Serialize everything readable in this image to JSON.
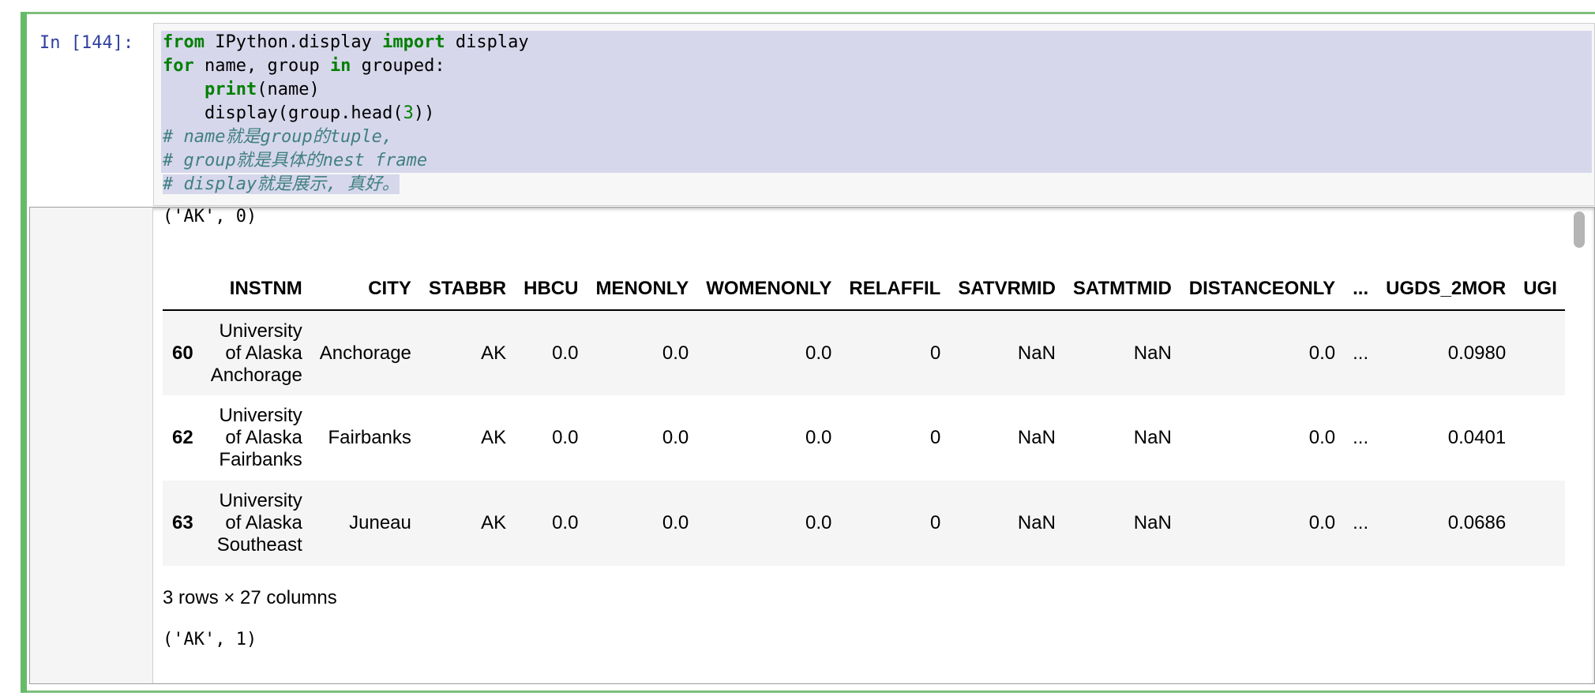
{
  "cell": {
    "prompt": "In [144]:",
    "code_lines": [
      [
        {
          "t": "from",
          "c": "kw"
        },
        {
          "t": " IPython.display ",
          "c": "plain"
        },
        {
          "t": "import",
          "c": "kw"
        },
        {
          "t": " display",
          "c": "plain"
        }
      ],
      [
        {
          "t": "for",
          "c": "kw"
        },
        {
          "t": " name, group ",
          "c": "plain"
        },
        {
          "t": "in",
          "c": "kw"
        },
        {
          "t": " grouped:",
          "c": "plain"
        }
      ],
      [
        {
          "t": "    ",
          "c": "plain"
        },
        {
          "t": "print",
          "c": "kw"
        },
        {
          "t": "(name)",
          "c": "plain"
        }
      ],
      [
        {
          "t": "    display(group.head(",
          "c": "plain"
        },
        {
          "t": "3",
          "c": "num"
        },
        {
          "t": "))",
          "c": "plain"
        }
      ],
      [
        {
          "t": "# name就是group的tuple,",
          "c": "cm"
        }
      ],
      [
        {
          "t": "# group就是具体的nest frame",
          "c": "cm"
        }
      ],
      [
        {
          "t": "# display就是展示, 真好。",
          "c": "cm"
        }
      ]
    ]
  },
  "output": {
    "group_label_0": "('AK', 0)",
    "group_label_1": "('AK', 1)",
    "rowcount": "3 rows × 27 columns",
    "table": {
      "columns": [
        "",
        "INSTNM",
        "CITY",
        "STABBR",
        "HBCU",
        "MENONLY",
        "WOMENONLY",
        "RELAFFIL",
        "SATVRMID",
        "SATMTMID",
        "DISTANCEONLY",
        "...",
        "UGDS_2MOR",
        "UGI"
      ],
      "rows": [
        {
          "index": "60",
          "instnm": [
            "University",
            "of Alaska",
            "Anchorage"
          ],
          "city": "Anchorage",
          "stabbr": "AK",
          "hbcu": "0.0",
          "menonly": "0.0",
          "womenonly": "0.0",
          "relaffil": "0",
          "satvrmid": "NaN",
          "satmtmid": "NaN",
          "distanceonly": "0.0",
          "ellipsis": "...",
          "ugds_2mor": "0.0980"
        },
        {
          "index": "62",
          "instnm": [
            "University",
            "of Alaska",
            "Fairbanks"
          ],
          "city": "Fairbanks",
          "stabbr": "AK",
          "hbcu": "0.0",
          "menonly": "0.0",
          "womenonly": "0.0",
          "relaffil": "0",
          "satvrmid": "NaN",
          "satmtmid": "NaN",
          "distanceonly": "0.0",
          "ellipsis": "...",
          "ugds_2mor": "0.0401"
        },
        {
          "index": "63",
          "instnm": [
            "University",
            "of Alaska",
            "Southeast"
          ],
          "city": "Juneau",
          "stabbr": "AK",
          "hbcu": "0.0",
          "menonly": "0.0",
          "womenonly": "0.0",
          "relaffil": "0",
          "satvrmid": "NaN",
          "satmtmid": "NaN",
          "distanceonly": "0.0",
          "ellipsis": "...",
          "ugds_2mor": "0.0686"
        }
      ]
    }
  }
}
